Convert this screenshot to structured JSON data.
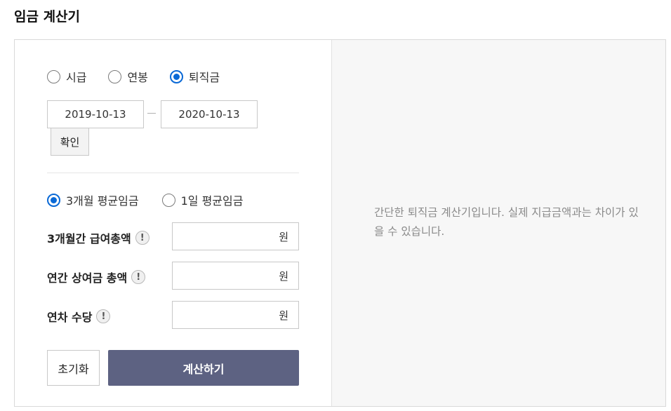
{
  "title": "임금 계산기",
  "mode_options": [
    {
      "label": "시급",
      "checked": false
    },
    {
      "label": "연봉",
      "checked": false
    },
    {
      "label": "퇴직금",
      "checked": true
    }
  ],
  "dates": {
    "start": "2019-10-13",
    "end": "2020-10-13"
  },
  "confirm_label": "확인",
  "avg_wage_options": [
    {
      "label": "3개월 평균임금",
      "checked": true
    },
    {
      "label": "1일 평균임금",
      "checked": false
    }
  ],
  "fields": [
    {
      "label": "3개월간 급여총액",
      "unit": "원",
      "value": ""
    },
    {
      "label": "연간 상여금 총액",
      "unit": "원",
      "value": ""
    },
    {
      "label": "연차 수당",
      "unit": "원",
      "value": ""
    }
  ],
  "info_icon_glyph": "!",
  "buttons": {
    "reset": "초기화",
    "calculate": "계산하기"
  },
  "notice": "간단한 퇴직금 계산기입니다. 실제 지급금액과는 차이가 있을 수 있습니다.",
  "colors": {
    "accent": "#0a69d6",
    "calc_button": "#5d6282",
    "right_panel_bg": "#f7f7f7"
  },
  "icons": {
    "info": "exclamation-circle-icon"
  }
}
